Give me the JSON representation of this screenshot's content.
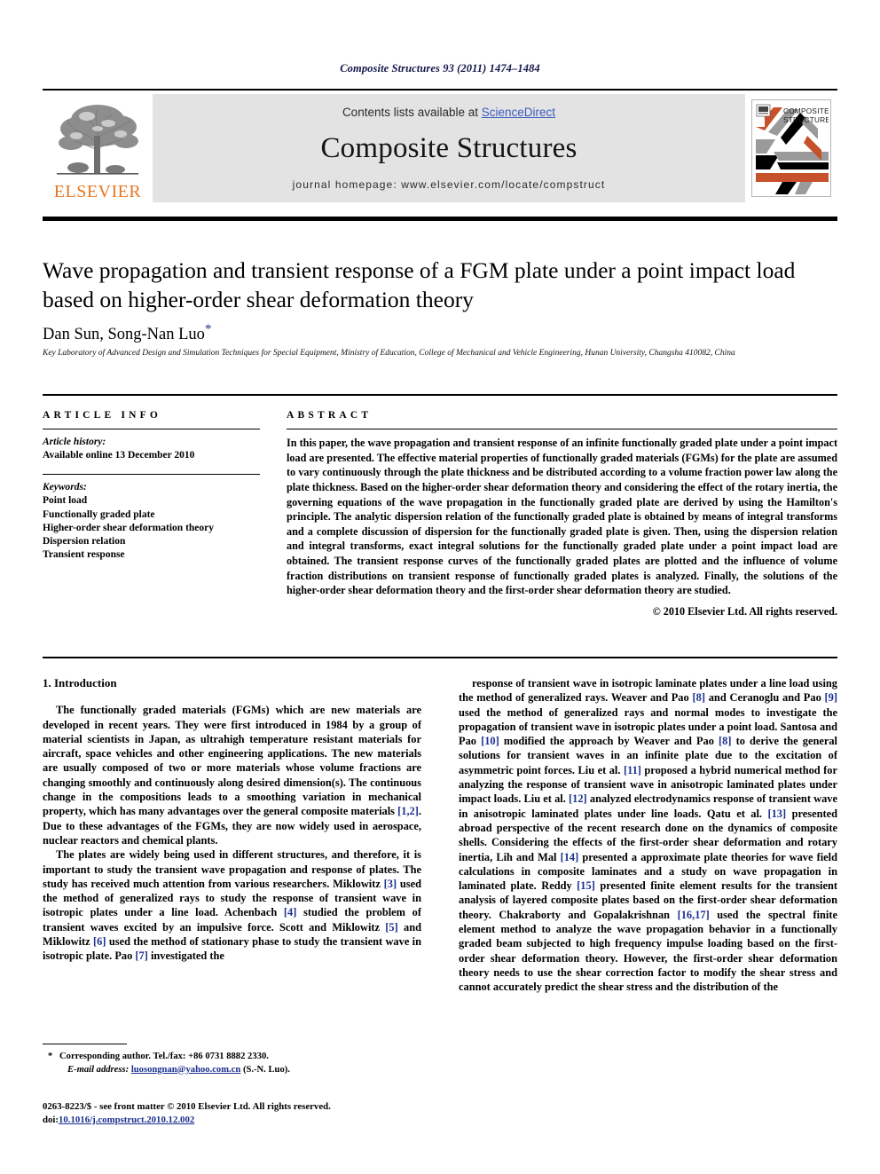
{
  "running_head": "Composite Structures 93 (2011) 1474–1484",
  "masthead": {
    "contents_prefix": "Contents lists available at ",
    "sciencedirect": "ScienceDirect",
    "journal_name": "Composite Structures",
    "homepage": "journal homepage: www.elsevier.com/locate/compstruct",
    "publisher_wordmark": "ELSEVIER",
    "cover_title_line1": "COMPOSITE",
    "cover_title_line2": "STRUCTURES",
    "accent_orange": "#c7512a",
    "accent_grey": "#9a9a9a",
    "elsevier_orange": "#e87722",
    "masthead_bg": "#e3e3e3",
    "link_blue": "#3b5bbf"
  },
  "article": {
    "title": "Wave propagation and transient response of a FGM plate under a point impact load based on higher-order shear deformation theory",
    "authors": "Dan Sun, Song-Nan Luo",
    "corresponding_marker": "*",
    "affiliation": "Key Laboratory of Advanced Design and Simulation Techniques for Special Equipment, Ministry of Education, College of Mechanical and Vehicle Engineering, Hunan University, Changsha 410082, China"
  },
  "article_info": {
    "heading": "ARTICLE INFO",
    "history_label": "Article history:",
    "history_line": "Available online 13 December 2010",
    "keywords_label": "Keywords:",
    "keywords": [
      "Point load",
      "Functionally graded plate",
      "Higher-order shear deformation theory",
      "Dispersion relation",
      "Transient response"
    ]
  },
  "abstract": {
    "heading": "ABSTRACT",
    "text": "In this paper, the wave propagation and transient response of an infinite functionally graded plate under a point impact load are presented. The effective material properties of functionally graded materials (FGMs) for the plate are assumed to vary continuously through the plate thickness and be distributed according to a volume fraction power law along the plate thickness. Based on the higher-order shear deformation theory and considering the effect of the rotary inertia, the governing equations of the wave propagation in the functionally graded plate are derived by using the Hamilton's principle. The analytic dispersion relation of the functionally graded plate is obtained by means of integral transforms and a complete discussion of dispersion for the functionally graded plate is given. Then, using the dispersion relation and integral transforms, exact integral solutions for the functionally graded plate under a point impact load are obtained. The transient response curves of the functionally graded plates are plotted and the influence of volume fraction distributions on transient response of functionally graded plates is analyzed. Finally, the solutions of the higher-order shear deformation theory and the first-order shear deformation theory are studied.",
    "copyright": "© 2010 Elsevier Ltd. All rights reserved."
  },
  "body": {
    "section_heading": "1. Introduction",
    "left_paragraphs": [
      "The functionally graded materials (FGMs) which are new materials are developed in recent years. They were first introduced in 1984 by a group of material scientists in Japan, as ultrahigh temperature resistant materials for aircraft, space vehicles and other engineering applications. The new materials are usually composed of two or more materials whose volume fractions are changing smoothly and continuously along desired dimension(s). The continuous change in the compositions leads to a smoothing variation in mechanical property, which has many advantages over the general composite materials [1,2]. Due to these advantages of the FGMs, they are now widely used in aerospace, nuclear reactors and chemical plants.",
      "The plates are widely being used in different structures, and therefore, it is important to study the transient wave propagation and response of plates. The study has received much attention from various researchers. Miklowitz [3] used the method of generalized rays to study the response of transient wave in isotropic plates under a line load. Achenbach [4] studied the problem of transient waves excited by an impulsive force. Scott and Miklowitz [5] and Miklowitz [6] used the method of stationary phase to study the transient wave in isotropic plate. Pao [7] investigated the"
    ],
    "right_paragraphs": [
      "response of transient wave in isotropic laminate plates under a line load using the method of generalized rays. Weaver and Pao [8] and Ceranoglu and Pao [9] used the method of generalized rays and normal modes to investigate the propagation of transient wave in isotropic plates under a point load. Santosa and Pao [10] modified the approach by Weaver and Pao [8] to derive the general solutions for transient waves in an infinite plate due to the excitation of asymmetric point forces. Liu et al. [11] proposed a hybrid numerical method for analyzing the response of transient wave in anisotropic laminated plates under impact loads. Liu et al. [12] analyzed electrodynamics response of transient wave in anisotropic laminated plates under line loads. Qatu et al. [13] presented abroad perspective of the recent research done on the dynamics of composite shells. Considering the effects of the first-order shear deformation and rotary inertia, Lih and Mal [14] presented a approximate plate theories for wave field calculations in composite laminates and a study on wave propagation in laminated plate. Reddy [15] presented finite element results for the transient analysis of layered composite plates based on the first-order shear deformation theory. Chakraborty and Gopalakrishnan [16,17] used the spectral finite element method to analyze the wave propagation behavior in a functionally graded beam subjected to high frequency impulse loading based on the first-order shear deformation theory. However, the first-order shear deformation theory needs to use the shear correction factor to modify the shear stress and cannot accurately predict the shear stress and the distribution of the"
    ]
  },
  "footnote": {
    "star": "*",
    "corresponding": "Corresponding author. Tel./fax: +86 0731 8882 2330.",
    "email_label": "E-mail address:",
    "email": "luosongnan@yahoo.com.cn",
    "email_owner": "(S.-N. Luo)."
  },
  "imprint": {
    "line1": "0263-8223/$ - see front matter © 2010 Elsevier Ltd. All rights reserved.",
    "doi_label": "doi:",
    "doi": "10.1016/j.compstruct.2010.12.002"
  }
}
